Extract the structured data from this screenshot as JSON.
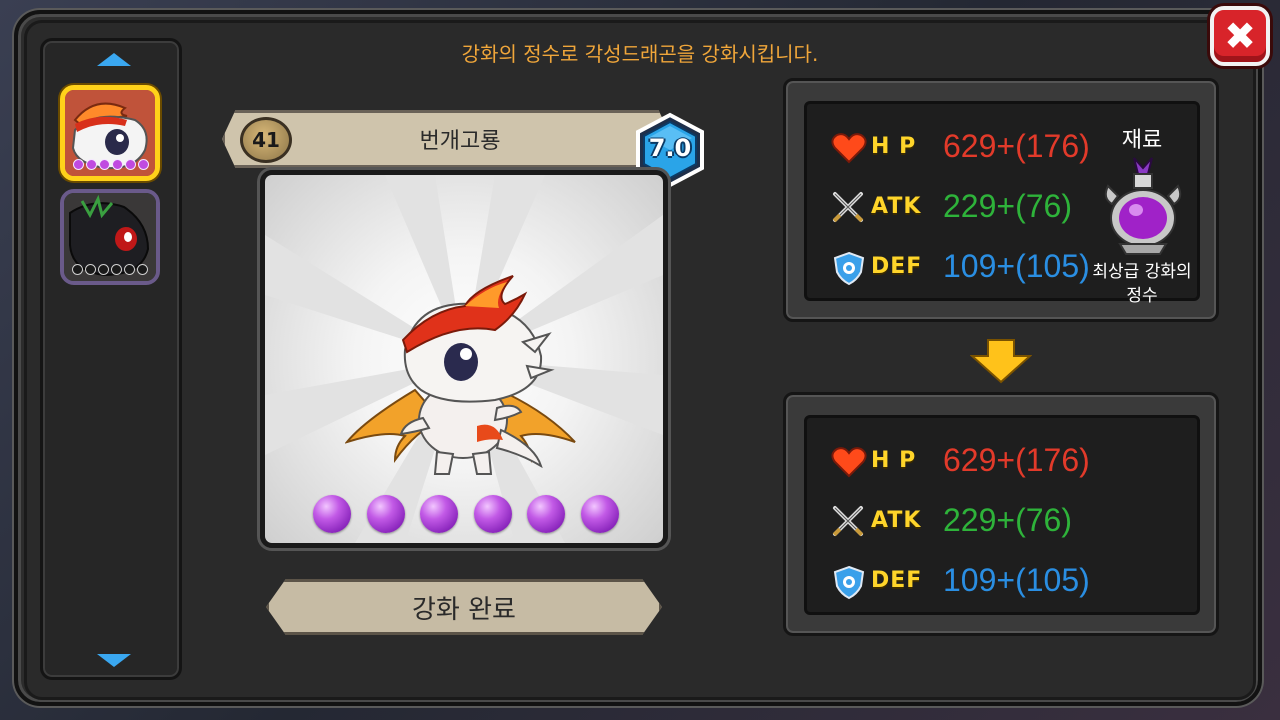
{
  "header": {
    "instruction": "강화의 정수로 각성드래곤을 강화시킵니다."
  },
  "close_button": {
    "label": "✖"
  },
  "sidebar": {
    "items": [
      {
        "name": "dragon-thumb-fire",
        "selected": true,
        "gems_filled": 6
      },
      {
        "name": "dragon-thumb-dark",
        "selected": false,
        "gems_filled": 0
      }
    ]
  },
  "dragon": {
    "level": "41",
    "name": "번개고룡",
    "grade": "7.0",
    "orbs": 6
  },
  "complete_button": {
    "label": "강화 완료"
  },
  "stats_before": {
    "hp_label": "H P",
    "hp_value": "629+(176)",
    "atk_label": "ATK",
    "atk_value": "229+(76)",
    "def_label": "DEF",
    "def_value": "109+(105)"
  },
  "material": {
    "title": "재료",
    "name_line1": "최상급 강화의",
    "name_line2": "정수"
  },
  "stats_after": {
    "hp_label": "H P",
    "hp_value": "629+(176)",
    "atk_label": "ATK",
    "atk_value": "229+(76)",
    "def_label": "DEF",
    "def_value": "109+(105)"
  },
  "colors": {
    "accent": "#f0a63a",
    "hp": "#e23a2a",
    "atk": "#2eb33a",
    "def": "#2a8ee2",
    "label": "#ffd52a"
  }
}
